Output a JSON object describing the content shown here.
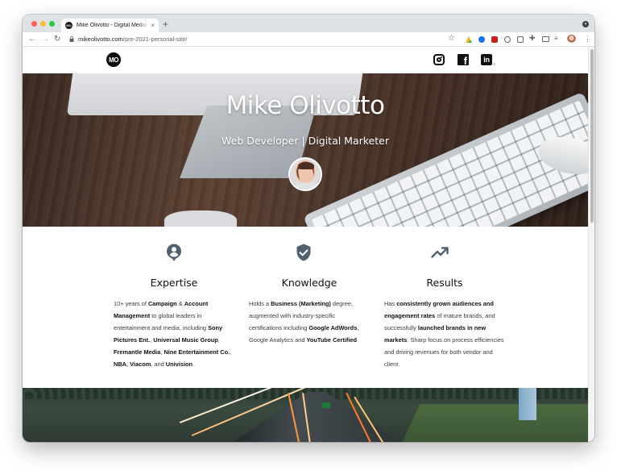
{
  "browser": {
    "tab": {
      "favicon_text": "MO",
      "title": "Mike Olivotto - Digital Media & Tech",
      "close": "×"
    },
    "new_tab": "+",
    "nav": {
      "back": "←",
      "forward": "→",
      "reload": "↻"
    },
    "url": {
      "domain": "mikeolivotto.com",
      "path": "/pre-2021-personal-site/"
    },
    "star": "☆",
    "puzzle": "✚",
    "playlist": "≡",
    "menu": "⋮"
  },
  "site": {
    "logo": "MO",
    "social": {
      "facebook": "f",
      "linkedin": "in",
      "linkedin_suffix": "®"
    },
    "hero": {
      "title": "Mike Olivotto",
      "subtitle": "Web Developer | Digital Marketer"
    },
    "features": [
      {
        "icon": "person-pin-icon",
        "heading": "Expertise",
        "body": [
          {
            "t": "10+ years of "
          },
          {
            "t": "Campaign",
            "b": true
          },
          {
            "t": " & "
          },
          {
            "t": "Account Management",
            "b": true
          },
          {
            "t": " to global leaders in entertainment and media, including "
          },
          {
            "t": "Sony Pictures Ent.",
            "b": true
          },
          {
            "t": ", "
          },
          {
            "t": "Universal Music Group",
            "b": true
          },
          {
            "t": ", "
          },
          {
            "t": "Fremantle Media",
            "b": true
          },
          {
            "t": ", "
          },
          {
            "t": "Nine Entertainment Co.",
            "b": true
          },
          {
            "t": ", "
          },
          {
            "t": "NBA",
            "b": true
          },
          {
            "t": ", "
          },
          {
            "t": "Viacom",
            "b": true
          },
          {
            "t": ", and "
          },
          {
            "t": "Univision",
            "b": true
          },
          {
            "t": "."
          }
        ]
      },
      {
        "icon": "verified-shield-icon",
        "heading": "Knowledge",
        "body": [
          {
            "t": "Holds a "
          },
          {
            "t": "Business (Marketing)",
            "b": true
          },
          {
            "t": " degree, augmented with industry-specific certifications including "
          },
          {
            "t": "Google AdWords",
            "b": true
          },
          {
            "t": ", Google Analytics and "
          },
          {
            "t": "YouTube Certified",
            "b": true
          }
        ]
      },
      {
        "icon": "trending-up-icon",
        "heading": "Results",
        "body": [
          {
            "t": "Has "
          },
          {
            "t": "consistently grown audiences and engagement rates",
            "b": true
          },
          {
            "t": " of mature brands, and successfully "
          },
          {
            "t": "launched brands in new markets",
            "b": true
          },
          {
            "t": ". Sharp focus on process efficiencies and driving revenues for both vendor and client."
          }
        ]
      }
    ],
    "colors": {
      "icon": "#50606e",
      "hero_text": "#ffffff"
    }
  }
}
